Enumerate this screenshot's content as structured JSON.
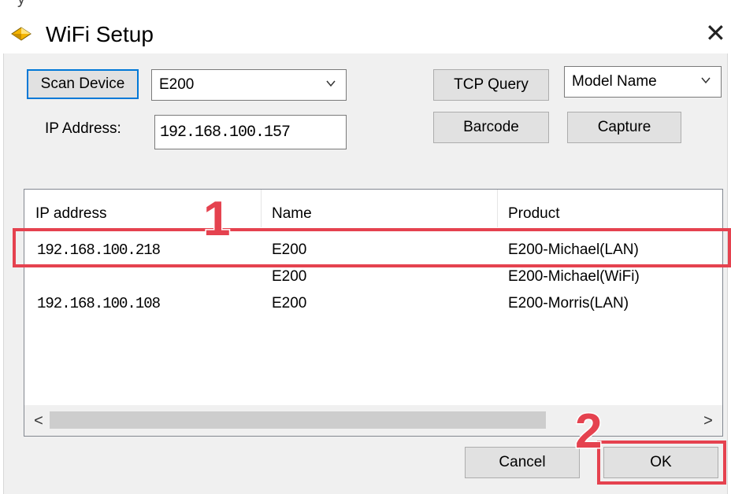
{
  "window": {
    "title": "WiFi Setup",
    "close_glyph": "✕",
    "app_icon": "diamond-app-icon",
    "top_glyph": "y"
  },
  "toolbar": {
    "scan_label": "Scan Device",
    "device_select": {
      "value": "E200"
    },
    "ip_label": "IP Address:",
    "ip_value": "192.168.100.157",
    "tcp_query_label": "TCP Query",
    "model_select": {
      "value": "Model Name"
    },
    "barcode_label": "Barcode",
    "capture_label": "Capture"
  },
  "device_list": {
    "columns": [
      "IP address",
      "Name",
      "Product"
    ],
    "rows": [
      {
        "ip": "192.168.100.218",
        "name": "E200",
        "product": "E200-Michael(LAN)"
      },
      {
        "ip": "",
        "name": "E200",
        "product": "E200-Michael(WiFi)"
      },
      {
        "ip": "192.168.100.108",
        "name": "E200",
        "product": "E200-Morris(LAN)"
      }
    ],
    "scroll_left": "<",
    "scroll_right": ">"
  },
  "footer": {
    "cancel_label": "Cancel",
    "ok_label": "OK"
  },
  "annotations": {
    "step1": "1",
    "step2": "2",
    "highlight_color": "#e5424f"
  },
  "colors": {
    "focus_border": "#0078d7",
    "dialog_bg": "#f0f0f0",
    "button_bg": "#e1e1e1"
  }
}
